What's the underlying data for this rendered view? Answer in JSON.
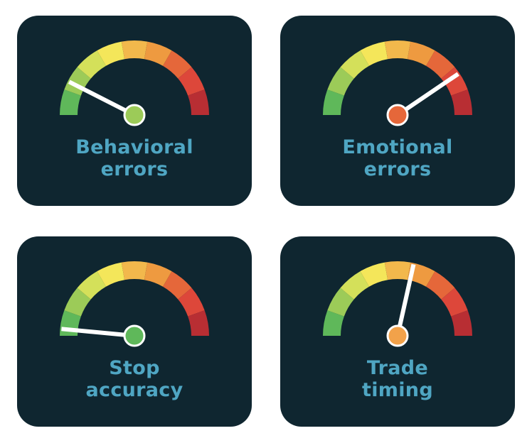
{
  "gauge_colors": [
    "#5fb85a",
    "#9ccb58",
    "#d4e05a",
    "#f4e65a",
    "#f2b84c",
    "#ee9a40",
    "#e5673a",
    "#dd473a",
    "#b82e33"
  ],
  "label_color": "#4fa6c3",
  "card_color": "#0f2630",
  "gauges": [
    {
      "line1": "Behavioral",
      "line2": "errors",
      "level": 0.15,
      "hub_color": "#9ccb58"
    },
    {
      "line1": "Emotional",
      "line2": "errors",
      "level": 0.81,
      "hub_color": "#e5673a"
    },
    {
      "line1": "Stop",
      "line2": "accuracy",
      "level": 0.03,
      "hub_color": "#5fb85a"
    },
    {
      "line1": "Trade",
      "line2": "timing",
      "level": 0.57,
      "hub_color": "#f2a24a"
    }
  ]
}
